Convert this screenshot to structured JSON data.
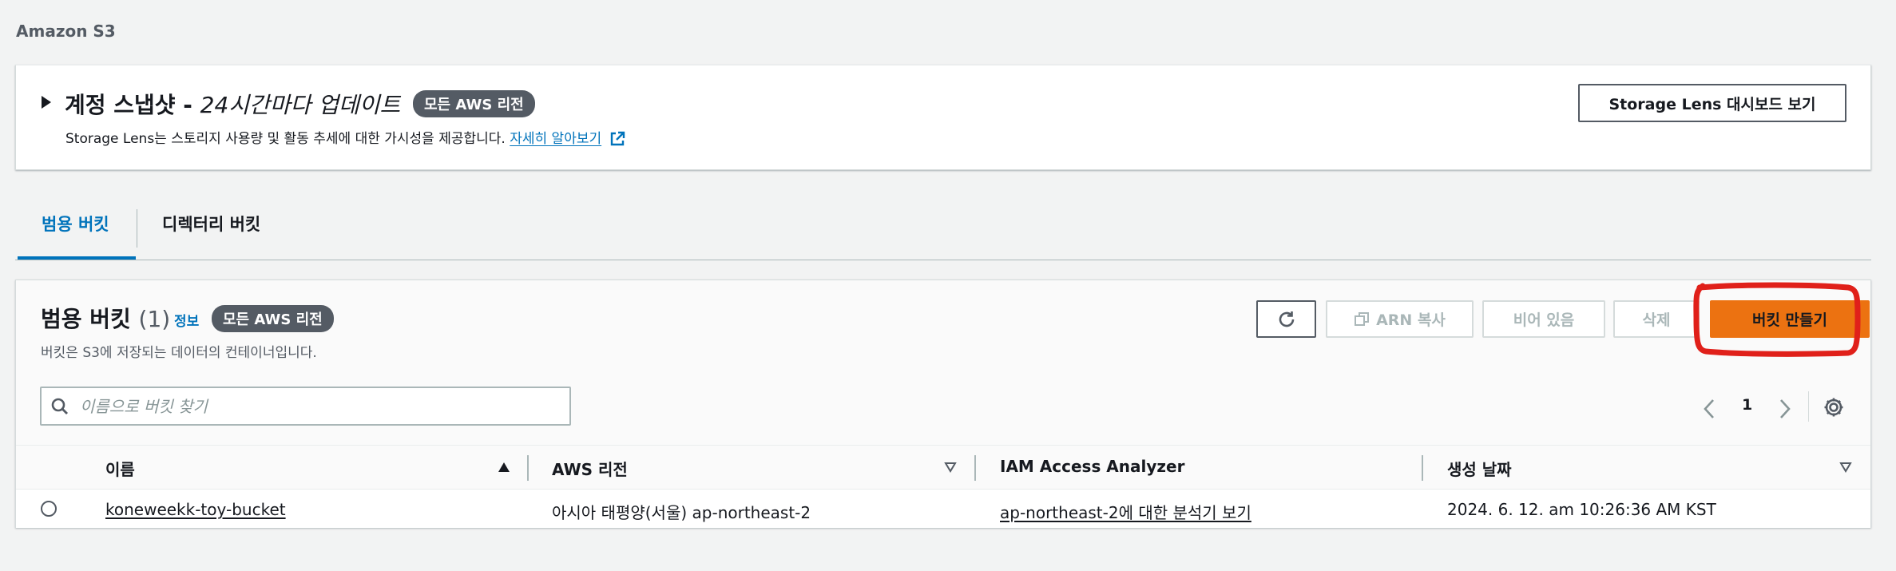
{
  "breadcrumb": "Amazon S3",
  "snapshot": {
    "title_bold": "계정 스냅샷 - ",
    "title_italic": "24시간마다 업데이트",
    "region_pill": "모든 AWS 리전",
    "description": "Storage Lens는 스토리지 사용량 및 활동 추세에 대한 가시성을 제공합니다.",
    "learn_more": "자세히 알아보기",
    "dashboard_button": "Storage Lens 대시보드 보기"
  },
  "tabs": [
    {
      "label": "범용 버킷",
      "active": true
    },
    {
      "label": "디렉터리 버킷",
      "active": false
    }
  ],
  "buckets": {
    "title": "범용 버킷",
    "count": "(1)",
    "info": "정보",
    "region_pill": "모든 AWS 리전",
    "description": "버킷은 S3에 저장되는 데이터의 컨테이너입니다.",
    "buttons": {
      "copy_arn": "ARN 복사",
      "empty": "비어 있음",
      "delete": "삭제",
      "create": "버킷 만들기"
    },
    "search_placeholder": "이름으로 버킷 찾기",
    "page": "1",
    "columns": [
      "이름",
      "AWS 리전",
      "IAM Access Analyzer",
      "생성 날짜"
    ],
    "rows": [
      {
        "name": "koneweekk-toy-bucket",
        "region": "아시아 태평양(서울) ap-northeast-2",
        "analyzer": "ap-northeast-2에 대한 분석기 보기",
        "created": "2024. 6. 12. am 10:26:36 AM KST"
      }
    ]
  },
  "colors": {
    "link": "#0073bb",
    "primary_button": "#ec7211",
    "annotation": "#e0201a"
  }
}
